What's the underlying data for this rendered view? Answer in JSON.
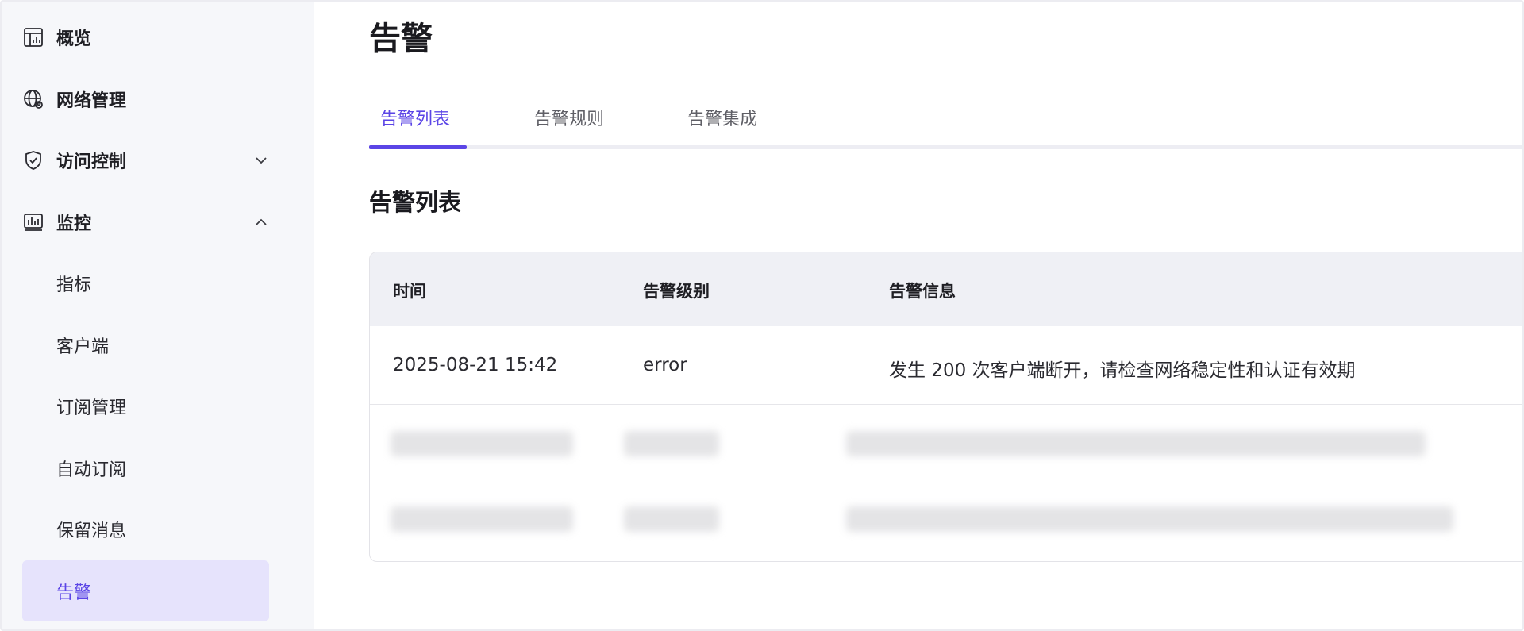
{
  "sidebar": {
    "items": [
      {
        "label": "概览",
        "icon": "dashboard-icon"
      },
      {
        "label": "网络管理",
        "icon": "network-globe-icon"
      },
      {
        "label": "访问控制",
        "icon": "shield-check-icon",
        "expanded": false
      },
      {
        "label": "监控",
        "icon": "monitor-chart-icon",
        "expanded": true
      }
    ],
    "monitor_children": [
      {
        "label": "指标"
      },
      {
        "label": "客户端"
      },
      {
        "label": "订阅管理"
      },
      {
        "label": "自动订阅"
      },
      {
        "label": "保留消息"
      },
      {
        "label": "告警",
        "active": true
      }
    ]
  },
  "main": {
    "title": "告警",
    "tabs": [
      {
        "label": "告警列表",
        "active": true
      },
      {
        "label": "告警规则"
      },
      {
        "label": "告警集成"
      }
    ],
    "section_title": "告警列表",
    "table": {
      "columns": [
        "时间",
        "告警级别",
        "告警信息"
      ],
      "rows": [
        {
          "time": "2025-08-21 15:42",
          "level": "error",
          "message": "发生 200 次客户端断开，请检查网络稳定性和认证有效期"
        }
      ]
    }
  },
  "colors": {
    "accent": "#5b45e6",
    "active_bg": "#e6e3fc",
    "sidebar_bg": "#f6f7fa",
    "table_header_bg": "#eff0f5"
  }
}
